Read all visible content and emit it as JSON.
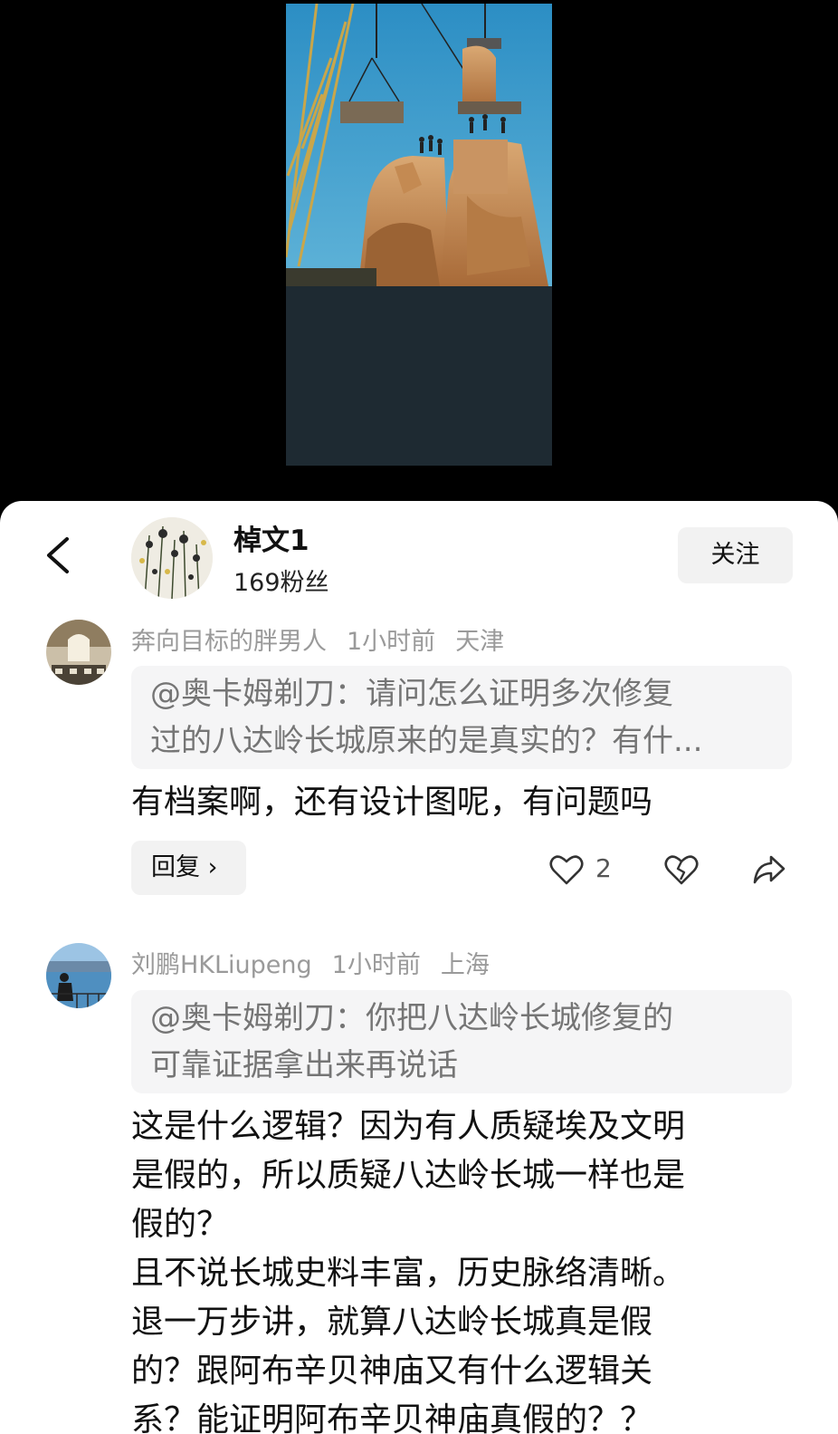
{
  "author": {
    "name": "棹文1",
    "fans": "169粉丝",
    "follow_label": "关注"
  },
  "comments": [
    {
      "user": "奔向目标的胖男人",
      "time": "1小时前",
      "location": "天津",
      "quote_line1": "@奥卡姆剃刀：请问怎么证明多次修复",
      "quote_line2": "过的八达岭长城原来的是真实的？有什...",
      "text": "有档案啊，还有设计图呢，有问题吗",
      "reply_label": "回复 ›",
      "likes": "2"
    },
    {
      "user": "刘鹏HKLiupeng",
      "time": "1小时前",
      "location": "上海",
      "quote_line1": "@奥卡姆剃刀：你把八达岭长城修复的",
      "quote_line2": "可靠证据拿出来再说话",
      "text_lines": [
        "这是什么逻辑？因为有人质疑埃及文明",
        "是假的，所以质疑八达岭长城一样也是",
        "假的？",
        "且不说长城史料丰富，历史脉络清晰。",
        "退一万步讲，就算八达岭长城真是假",
        "的？跟阿布辛贝神庙又有什么逻辑关",
        "系？能证明阿布辛贝神庙真假的？？"
      ]
    }
  ],
  "icons": {
    "back": "chevron-left-icon",
    "like": "heart-icon",
    "dislike": "broken-heart-icon",
    "share": "share-arrow-icon"
  },
  "colors": {
    "sheet_bg": "#ffffff",
    "meta_text": "#9a9a9a",
    "quote_bg": "#f5f5f6",
    "button_bg": "#f2f2f2"
  }
}
